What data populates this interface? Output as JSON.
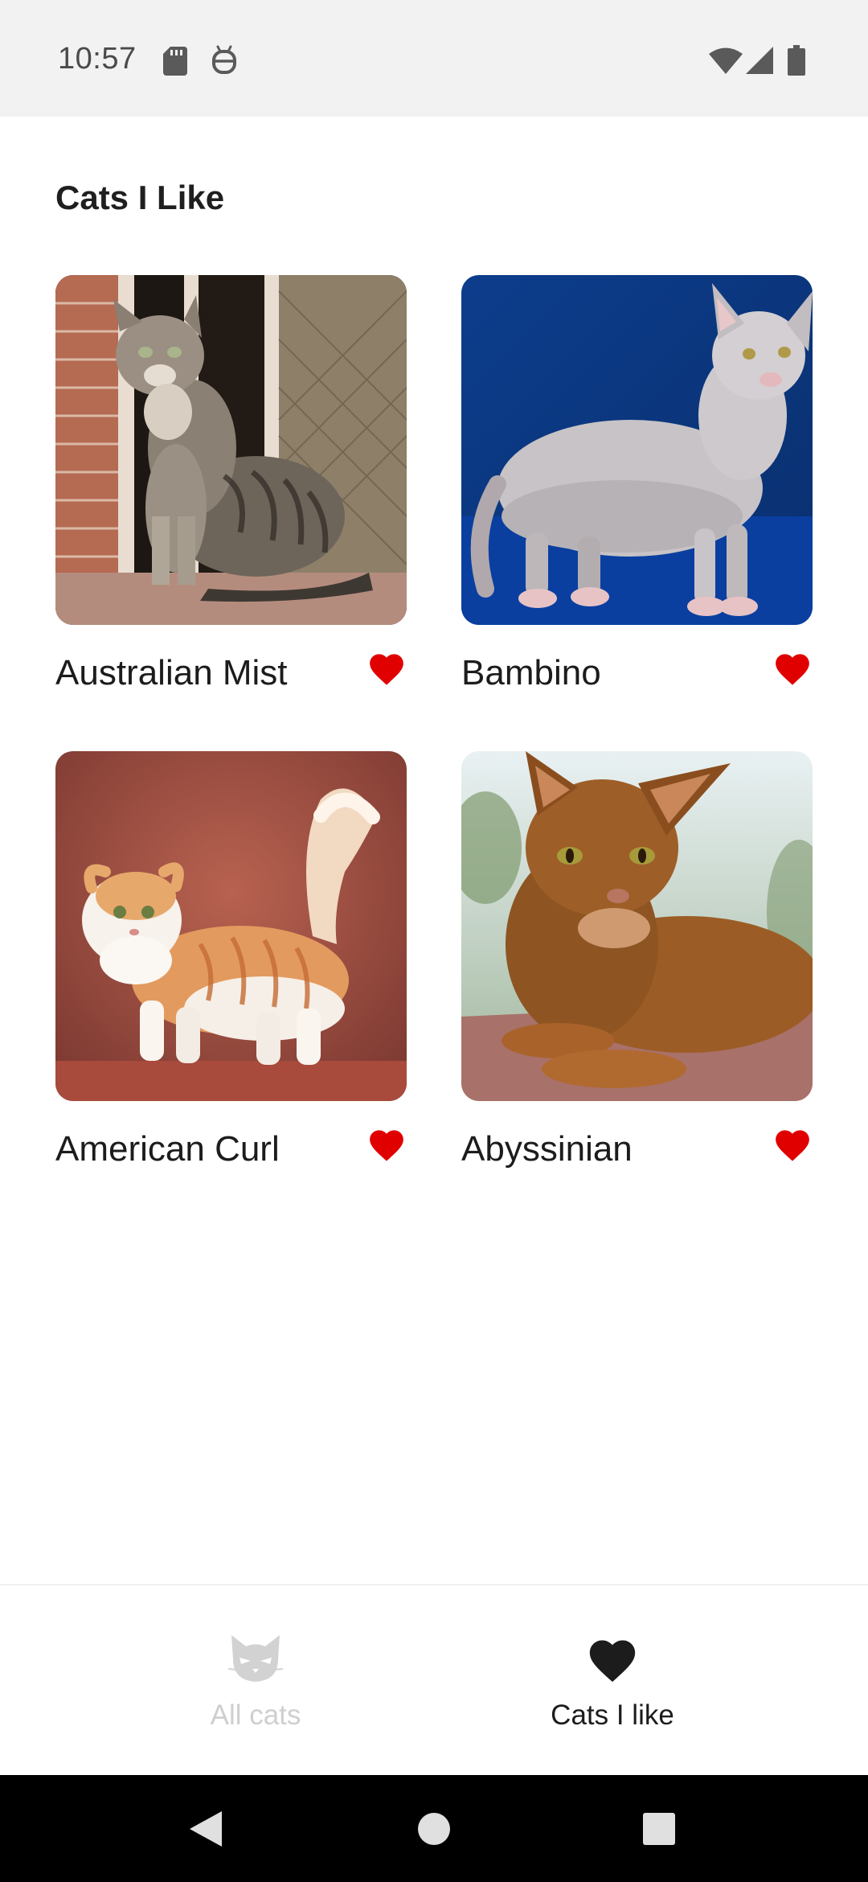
{
  "status_bar": {
    "time": "10:57",
    "icons": [
      "sd-card-icon",
      "android-debug-icon",
      "wifi-icon",
      "cellular-signal-icon",
      "battery-icon"
    ]
  },
  "page": {
    "title": "Cats I Like"
  },
  "cats": [
    {
      "name": "Australian Mist",
      "liked": true,
      "image": "tabby cat sitting by window"
    },
    {
      "name": "Bambino",
      "liked": true,
      "image": "hairless cat on blue background"
    },
    {
      "name": "American Curl",
      "liked": true,
      "image": "orange and white fluffy cat"
    },
    {
      "name": "Abyssinian",
      "liked": true,
      "image": "ruddy cat lying on stone"
    }
  ],
  "bottom_nav": {
    "items": [
      {
        "label": "All cats",
        "icon": "cat-face-icon",
        "active": false
      },
      {
        "label": "Cats I like",
        "icon": "heart-icon",
        "active": true
      }
    ]
  },
  "colors": {
    "heart_red": "#e00000",
    "nav_active": "#1c1c1c",
    "nav_inactive": "#cfcfcf",
    "status_bar_bg": "#f2f2f2"
  }
}
